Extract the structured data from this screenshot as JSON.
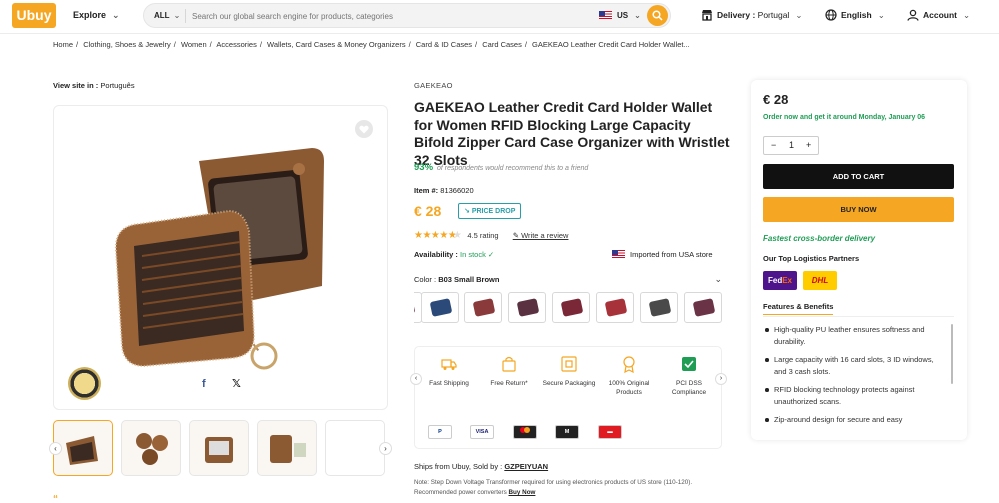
{
  "header": {
    "logo": "Ubuy",
    "explore_label": "Explore",
    "category": "ALL",
    "search_placeholder": "Search our global search engine for products, categories",
    "region": "US",
    "delivery_label": "Delivery :",
    "delivery_value": "Portugal",
    "language": "English",
    "account": "Account"
  },
  "breadcrumb": [
    "Home",
    "Clothing, Shoes & Jewelry",
    "Women",
    "Accessories",
    "Wallets, Card Cases & Money Organizers",
    "Card & ID Cases",
    "Card Cases",
    "GAEKEAO Leather Credit Card Holder Wallet..."
  ],
  "view_site": {
    "label": "View site in :",
    "value": "Português"
  },
  "gallery": {
    "thumb_count": 5,
    "quote_mark": "“",
    "genuine_badge": "GENUINE"
  },
  "product": {
    "brand": "GAEKEAO",
    "title": "GAEKEAO Leather Credit Card Holder Wallet for Women RFID Blocking Large Capacity Bifold Zipper Card Case Organizer with Wristlet 32 Slots",
    "recommend_percent": "93%",
    "recommend_text": "of respondents would recommend this to a friend",
    "item_label": "Item #:",
    "item_no": "81366020",
    "price": "€ 28",
    "price_drop": "PRICE DROP",
    "rating_value": 4.5,
    "rating_text": "4.5 rating",
    "write_review": "Write a review",
    "availability_label": "Availability :",
    "availability_value": "In stock",
    "imported": "Imported from USA store",
    "color_label": "Color :",
    "color_value": "B03 Small Brown",
    "swatch_colors": [
      "#2b4a7a",
      "#8a3a3a",
      "#5a3140",
      "#7a2838",
      "#a8323a",
      "#4a4a4a",
      "#6b3346"
    ],
    "features": [
      {
        "label": "Fast Shipping",
        "icon": "truck-icon"
      },
      {
        "label": "Free Return*",
        "icon": "bag-icon"
      },
      {
        "label": "Secure Packaging",
        "icon": "box-icon"
      },
      {
        "label": "100% Original Products",
        "icon": "medal-icon"
      },
      {
        "label": "PCI DSS Compliance",
        "icon": "shield-icon"
      }
    ],
    "payments": [
      "PayPal",
      "VISA",
      "MC",
      "Maestro",
      "Local"
    ],
    "ships_label": "Ships from Ubuy, Sold by :",
    "seller": "GZPEIYUAN",
    "note": "Note: Step Down Voltage Transformer required for using electronics products of US store (110-120). Recommended power converters",
    "note_link": "Buy Now"
  },
  "buybox": {
    "price": "€ 28",
    "delivery": "Order now and get it around Monday, January 06",
    "qty": "1",
    "add_to_cart": "ADD TO CART",
    "buy_now": "BUY NOW",
    "fast_delivery": "Fastest cross-border delivery",
    "logistics_title": "Our Top Logistics Partners",
    "fedex": "FedEx",
    "dhl": "DHL",
    "features_title": "Features & Benefits",
    "benefits": [
      "High-quality PU leather ensures softness and durability.",
      "Large capacity with 16 card slots, 3 ID windows, and 3 cash slots.",
      "RFID blocking technology protects against unauthorized scans.",
      "Zip-around design for secure and easy"
    ]
  },
  "colors": {
    "accent": "#f5a623",
    "green": "#1f9d55",
    "teal": "#2a9ea8"
  }
}
